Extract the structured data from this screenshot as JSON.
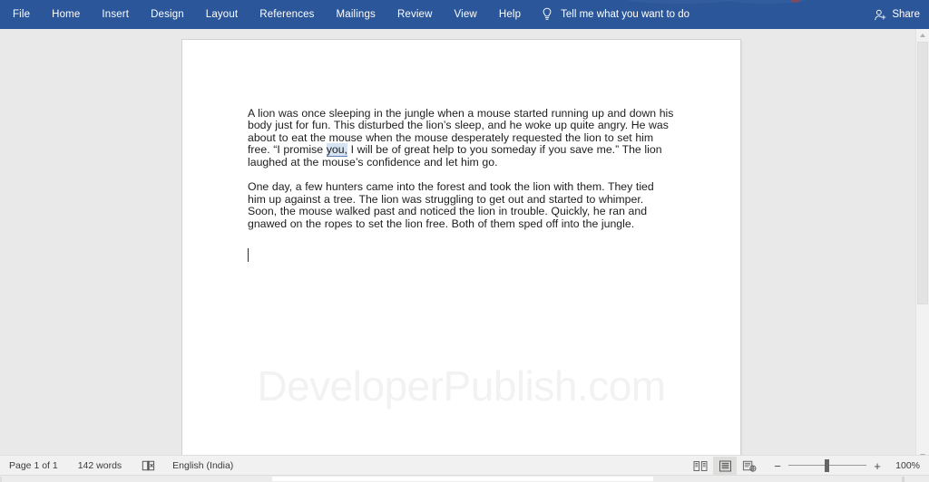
{
  "app": {
    "accent_color": "#2b579a",
    "canvas_color": "#e9e9e9",
    "page_color": "#ffffff"
  },
  "ribbon": {
    "tabs": [
      {
        "label": "File",
        "icon": "file-tab",
        "active": false
      },
      {
        "label": "Home",
        "icon": "home-tab",
        "active": false
      },
      {
        "label": "Insert",
        "icon": "insert-tab",
        "active": false
      },
      {
        "label": "Design",
        "icon": "design-tab",
        "active": false
      },
      {
        "label": "Layout",
        "icon": "layout-tab",
        "active": false
      },
      {
        "label": "References",
        "icon": "references-tab",
        "active": false
      },
      {
        "label": "Mailings",
        "icon": "mailings-tab",
        "active": false
      },
      {
        "label": "Review",
        "icon": "review-tab",
        "active": false
      },
      {
        "label": "View",
        "icon": "view-tab",
        "active": false
      },
      {
        "label": "Help",
        "icon": "help-tab",
        "active": false
      }
    ],
    "tell_me": {
      "label": "Tell me what you want to do",
      "icon": "lightbulb-icon"
    },
    "share": {
      "label": "Share",
      "icon": "share-person-icon"
    }
  },
  "document": {
    "paragraphs": [
      {
        "id": "para-1",
        "segments": [
          {
            "text": "A lion was once sleeping in the jungle when a mouse started running up and down his body just for fun. This disturbed the lion’s sleep, and he woke up quite angry. He was about to eat the mouse when the mouse desperately requested the lion to set him free. “I promise ",
            "style": "normal"
          },
          {
            "text": "you,",
            "style": "selected-underlined"
          },
          {
            "text": " I will be of great help to you someday if you save me.” The lion laughed at the mouse’s confidence and let him go.",
            "style": "normal"
          }
        ]
      },
      {
        "id": "para-2",
        "segments": [
          {
            "text": "One day, a few hunters came into the forest and took the lion with them. They tied him up against a tree. The lion was struggling to get out and started to whimper. Soon, the mouse walked past and noticed the lion in trouble. Quickly, he ran and gnawed on the ropes to set the lion free. Both of them sped off into the jungle.",
            "style": "normal"
          }
        ]
      }
    ],
    "watermark": "DeveloperPublish.com",
    "caret_visible": true
  },
  "status_bar": {
    "page_label": "Page 1 of 1",
    "word_count": "142 words",
    "proofing_icon": "proofing-errors-icon",
    "language": "English (India)",
    "views": [
      {
        "name": "read-mode-view-button",
        "icon": "read-mode-icon",
        "active": false
      },
      {
        "name": "print-layout-view-button",
        "icon": "print-layout-icon",
        "active": true
      },
      {
        "name": "web-layout-view-button",
        "icon": "web-layout-icon",
        "active": false
      }
    ],
    "zoom": {
      "minus_label": "−",
      "plus_label": "+",
      "level_label": "100%"
    }
  }
}
